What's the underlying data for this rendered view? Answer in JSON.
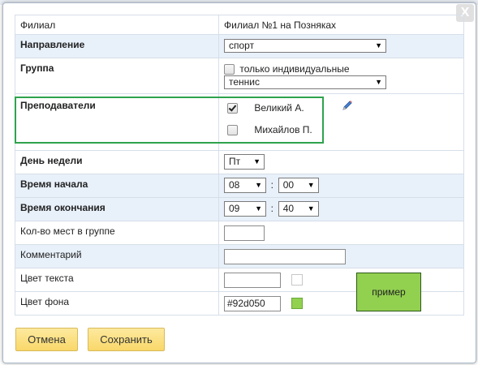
{
  "dialog": {
    "close_label": "X"
  },
  "rows": {
    "filial": {
      "label": "Филиал",
      "value": "Филиал №1 на Позняках"
    },
    "direction": {
      "label": "Направление",
      "selected": "спорт"
    },
    "group": {
      "label": "Группа",
      "individual_label": "только индивидуальные",
      "selected": "теннис"
    },
    "teachers": {
      "label": "Преподаватели",
      "items": [
        {
          "name": "Великий А.",
          "checked": true
        },
        {
          "name": "Михайлов П.",
          "checked": false
        }
      ]
    },
    "weekday": {
      "label": "День недели",
      "selected": "Пт"
    },
    "start_time": {
      "label": "Время начала",
      "hour": "08",
      "minute": "00",
      "separator": ":"
    },
    "end_time": {
      "label": "Время окончания",
      "hour": "09",
      "minute": "40",
      "separator": ":"
    },
    "seats": {
      "label": "Кол-во мест в группе",
      "value": ""
    },
    "comment": {
      "label": "Комментарий",
      "value": ""
    },
    "text_color": {
      "label": "Цвет текста",
      "value": ""
    },
    "bg_color": {
      "label": "Цвет фона",
      "value": "#92d050"
    }
  },
  "preview": {
    "label": "пример"
  },
  "buttons": {
    "cancel": "Отмена",
    "save": "Сохранить"
  },
  "colors": {
    "bg_swatch": "#92d050",
    "text_swatch": "#ffffff",
    "highlight_frame": "#2ea34d",
    "button_bg": "#fde17e"
  }
}
